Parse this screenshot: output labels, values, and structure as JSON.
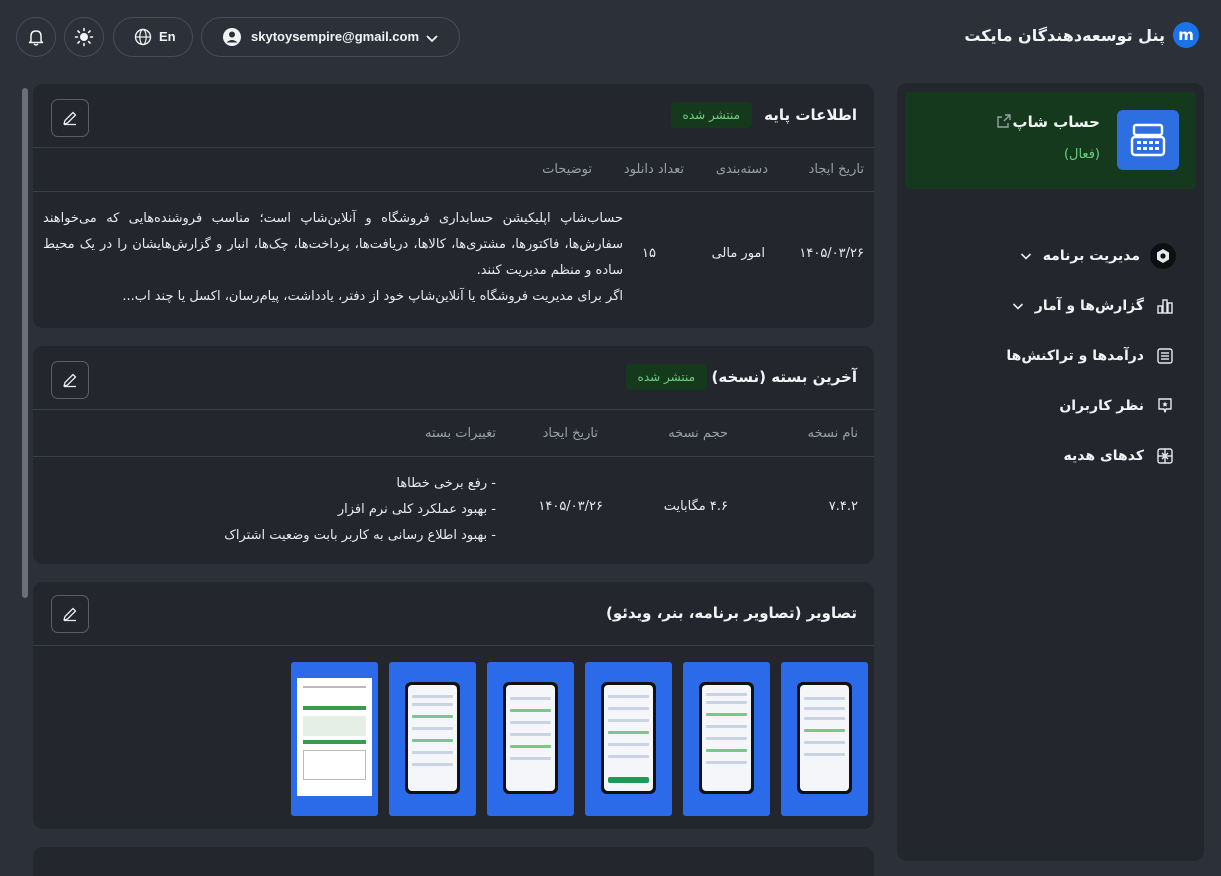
{
  "header": {
    "brand_logo": "m",
    "brand_title": "پنل توسعه‌دهندگان مایکت",
    "account_email": "skytoysempire@gmail.com",
    "language": "En"
  },
  "sidebar": {
    "app_name": "حساب شاپ",
    "app_status": "(فعال)",
    "items": [
      {
        "label": "مدیریت برنامه",
        "icon": "gear-icon"
      },
      {
        "label": "گزارش‌ها و آمار",
        "icon": "bar-chart-icon"
      },
      {
        "label": "درآمدها و تراکنش‌ها",
        "icon": "list-icon"
      },
      {
        "label": "نظر کاربران",
        "icon": "star-comment-icon"
      },
      {
        "label": "کدهای هدیه",
        "icon": "gift-icon"
      }
    ]
  },
  "basic_info": {
    "title": "اطلاعات پایه",
    "badge": "منتشر شده",
    "headers": [
      "تاریخ ایجاد",
      "دسته‌بندی",
      "تعداد دانلود",
      "توضیحات"
    ],
    "created": "۱۴۰۵/۰۳/۲۶",
    "category": "امور مالی",
    "downloads": "۱۵",
    "description": "حساب‌شاپ اپلیکیشن حسابداری فروشگاه و آنلاین‌شاپ است؛ مناسب فروشنده‌هایی که می‌خواهند سفارش‌ها، فاکتورها، مشتری‌ها، کالاها، دریافت‌ها، پرداخت‌ها، چک‌ها، انبار و گزارش‌هایشان را در یک محیط ساده و منظم مدیریت کنند.",
    "description_2": "اگر برای مدیریت فروشگاه یا آنلاین‌شاپ خود از دفتر، یادداشت، پیام‌رسان، اکسل یا چند اب..."
  },
  "latest_package": {
    "title": "آخرین بسته (نسخه)",
    "badge": "منتشر شده",
    "headers": [
      "نام نسخه",
      "حجم نسخه",
      "تاریخ ایجاد",
      "تغییرات بسته"
    ],
    "version": "۷.۴.۲",
    "size": "۴.۶ مگابایت",
    "created": "۱۴۰۵/۰۳/۲۶",
    "changes": [
      "- رفع برخی خطاها",
      "- بهبود عملکرد کلی نرم افزار",
      "- بهبود اطلاع رسانی به کاربر بابت وضعیت اشتراک"
    ]
  },
  "images": {
    "title": "تصاویر (تصاویر برنامه، بنر، ویدئو)"
  }
}
